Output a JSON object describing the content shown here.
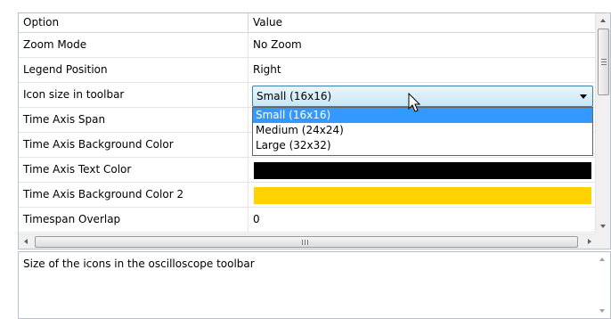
{
  "grid": {
    "header": {
      "option": "Option",
      "value": "Value"
    },
    "rows": [
      {
        "option": "Zoom Mode",
        "value": "No Zoom"
      },
      {
        "option": "Legend Position",
        "value": "Right"
      },
      {
        "option": "Icon size in toolbar",
        "value": "Small (16x16)"
      },
      {
        "option": "Time Axis Span",
        "value": ""
      },
      {
        "option": "Time Axis Background Color",
        "value": ""
      },
      {
        "option": "Time Axis Text Color",
        "value": "",
        "color": "#000000"
      },
      {
        "option": "Time Axis Background Color 2",
        "value": "",
        "color": "#ffd200"
      },
      {
        "option": "Timespan Overlap",
        "value": "0"
      }
    ]
  },
  "dropdown": {
    "selected": "Small (16x16)",
    "options": [
      "Small (16x16)",
      "Medium (24x24)",
      "Large (32x32)"
    ]
  },
  "description": {
    "text": "Size of the icons in the oscilloscope toolbar"
  },
  "colors": {
    "selection": "#3399ff",
    "combo_border": "#3c7fb1"
  },
  "icons": [
    "chevron-down-icon",
    "scroll-up-icon",
    "scroll-down-icon",
    "scroll-left-icon",
    "scroll-right-icon",
    "mouse-cursor-icon"
  ]
}
